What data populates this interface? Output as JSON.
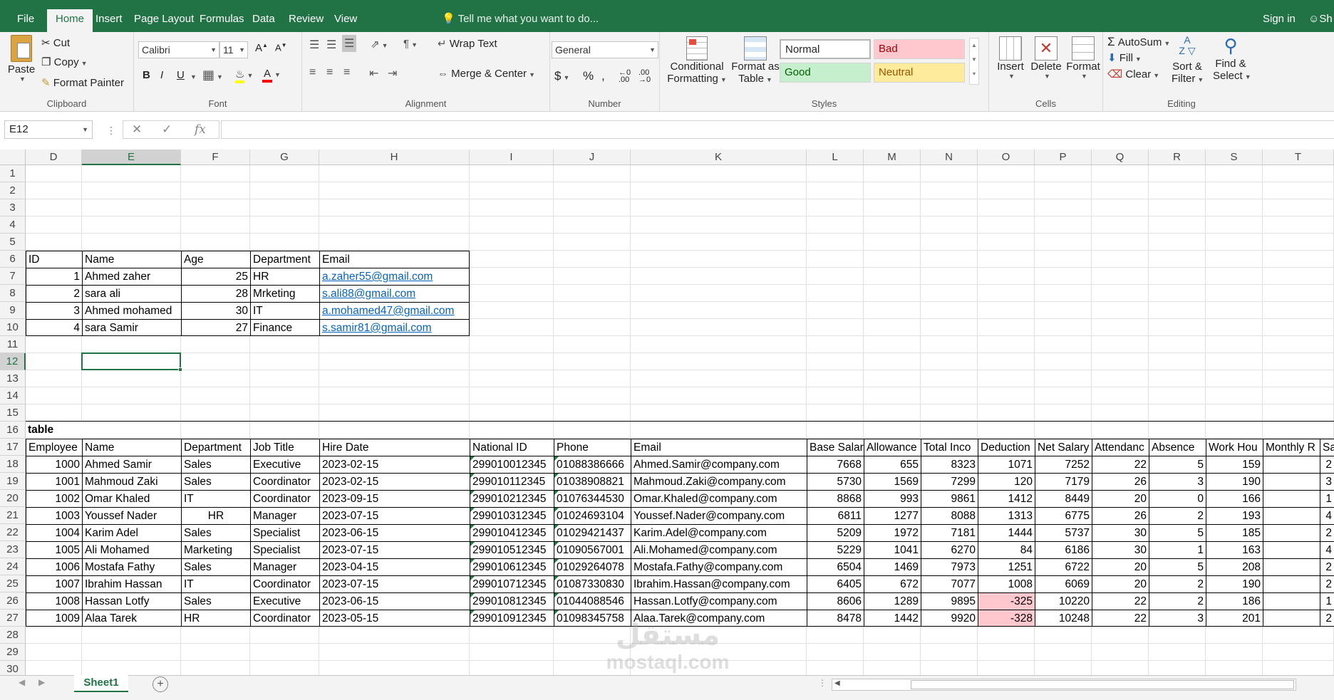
{
  "tabs": [
    "File",
    "Home",
    "Insert",
    "Page Layout",
    "Formulas",
    "Data",
    "Review",
    "View"
  ],
  "active_tab": "Home",
  "tell_me": "Tell me what you want to do...",
  "sign_in": "Sign in",
  "share": "Sh",
  "ribbon": {
    "clipboard": {
      "paste": "Paste",
      "cut": "Cut",
      "copy": "Copy",
      "format_painter": "Format Painter",
      "label": "Clipboard"
    },
    "font": {
      "name": "Calibri",
      "size": "11",
      "label": "Font",
      "bold": "B",
      "italic": "I",
      "underline": "U"
    },
    "alignment": {
      "wrap_text": "Wrap Text",
      "merge_center": "Merge & Center",
      "label": "Alignment"
    },
    "number": {
      "format": "General",
      "label": "Number"
    },
    "styles": {
      "conditional_1": "Conditional",
      "conditional_2": "Formatting",
      "format_table_1": "Format as",
      "format_table_2": "Table",
      "normal": "Normal",
      "bad": "Bad",
      "good": "Good",
      "neutral": "Neutral",
      "label": "Styles"
    },
    "cells": {
      "insert": "Insert",
      "delete": "Delete",
      "format": "Format",
      "label": "Cells"
    },
    "editing": {
      "autosum": "AutoSum",
      "fill": "Fill",
      "clear": "Clear",
      "sort_1": "Sort &",
      "sort_2": "Filter",
      "find_1": "Find &",
      "find_2": "Select",
      "label": "Editing"
    }
  },
  "name_box": "E12",
  "fx": "fx",
  "columns": [
    "D",
    "E",
    "F",
    "G",
    "H",
    "I",
    "J",
    "K",
    "L",
    "M",
    "N",
    "O",
    "P",
    "Q",
    "R",
    "S",
    "T"
  ],
  "rows": [
    "1",
    "2",
    "3",
    "4",
    "5",
    "6",
    "7",
    "8",
    "9",
    "10",
    "11",
    "12",
    "13",
    "14",
    "15",
    "16",
    "17",
    "18",
    "19",
    "20",
    "21",
    "22",
    "23",
    "24",
    "25",
    "26",
    "27",
    "28",
    "29",
    "30"
  ],
  "table1": {
    "headers": [
      "ID",
      "Name",
      "Age",
      "Department",
      "Email"
    ],
    "rows": [
      [
        "1",
        "Ahmed zaher",
        "25",
        "HR",
        "a.zaher55@gmail.com"
      ],
      [
        "2",
        "sara ali",
        "28",
        "Mrketing",
        "s.ali88@gmail.com"
      ],
      [
        "3",
        "Ahmed mohamed",
        "30",
        "IT",
        "a.mohamed47@gmail.com"
      ],
      [
        "4",
        "sara Samir",
        "27",
        "Finance",
        "s.samir81@gmail.com"
      ]
    ]
  },
  "table2": {
    "caption": "table",
    "headers": [
      "Employee",
      "Name",
      "Department",
      "Job Title",
      "Hire Date",
      "National ID",
      "Phone",
      "Email",
      "Base Salar",
      "Allowance",
      "Total Inco",
      "Deduction",
      "Net Salary",
      "Attendanc",
      "Absence",
      "Work Hou",
      "Monthly R",
      "Sal"
    ],
    "rows": [
      [
        "1000",
        "Ahmed Samir",
        "Sales",
        "Executive",
        "2023-02-15",
        "299010012345",
        "01088386666",
        "Ahmed.Samir@company.com",
        "7668",
        "655",
        "8323",
        "1071",
        "7252",
        "22",
        "5",
        "159",
        "2"
      ],
      [
        "1001",
        "Mahmoud Zaki",
        "Sales",
        "Coordinator",
        "2023-02-15",
        "299010112345",
        "01038908821",
        "Mahmoud.Zaki@company.com",
        "5730",
        "1569",
        "7299",
        "120",
        "7179",
        "26",
        "3",
        "190",
        "3"
      ],
      [
        "1002",
        "Omar Khaled",
        "IT",
        "Coordinator",
        "2023-09-15",
        "299010212345",
        "01076344530",
        "Omar.Khaled@company.com",
        "8868",
        "993",
        "9861",
        "1412",
        "8449",
        "20",
        "0",
        "166",
        "1"
      ],
      [
        "1003",
        "Youssef Nader",
        "HR",
        "Manager",
        "2023-07-15",
        "299010312345",
        "01024693104",
        "Youssef.Nader@company.com",
        "6811",
        "1277",
        "8088",
        "1313",
        "6775",
        "26",
        "2",
        "193",
        "4"
      ],
      [
        "1004",
        "Karim Adel",
        "Sales",
        "Specialist",
        "2023-06-15",
        "299010412345",
        "01029421437",
        "Karim.Adel@company.com",
        "5209",
        "1972",
        "7181",
        "1444",
        "5737",
        "30",
        "5",
        "185",
        "2"
      ],
      [
        "1005",
        "Ali Mohamed",
        "Marketing",
        "Specialist",
        "2023-07-15",
        "299010512345",
        "01090567001",
        "Ali.Mohamed@company.com",
        "5229",
        "1041",
        "6270",
        "84",
        "6186",
        "30",
        "1",
        "163",
        "4"
      ],
      [
        "1006",
        "Mostafa Fathy",
        "Sales",
        "Manager",
        "2023-04-15",
        "299010612345",
        "01029264078",
        "Mostafa.Fathy@company.com",
        "6504",
        "1469",
        "7973",
        "1251",
        "6722",
        "20",
        "5",
        "208",
        "2"
      ],
      [
        "1007",
        "Ibrahim Hassan",
        "IT",
        "Coordinator",
        "2023-07-15",
        "299010712345",
        "01087330830",
        "Ibrahim.Hassan@company.com",
        "6405",
        "672",
        "7077",
        "1008",
        "6069",
        "20",
        "2",
        "190",
        "2"
      ],
      [
        "1008",
        "Hassan Lotfy",
        "Sales",
        "Executive",
        "2023-06-15",
        "299010812345",
        "01044088546",
        "Hassan.Lotfy@company.com",
        "8606",
        "1289",
        "9895",
        "-325",
        "10220",
        "22",
        "2",
        "186",
        "1"
      ],
      [
        "1009",
        "Alaa Tarek",
        "HR",
        "Coordinator",
        "2023-05-15",
        "299010912345",
        "01098345758",
        "Alaa.Tarek@company.com",
        "8478",
        "1442",
        "9920",
        "-328",
        "10248",
        "22",
        "3",
        "201",
        "2"
      ]
    ]
  },
  "sheet_tab": "Sheet1",
  "watermark_1": "مستقل",
  "watermark_2": "mostaql.com",
  "colors": {
    "excel_green": "#217346",
    "link": "#0563c1",
    "bad_fill": "#ffc7ce",
    "good_fill": "#c6efce",
    "neutral_fill": "#ffeb9c"
  }
}
